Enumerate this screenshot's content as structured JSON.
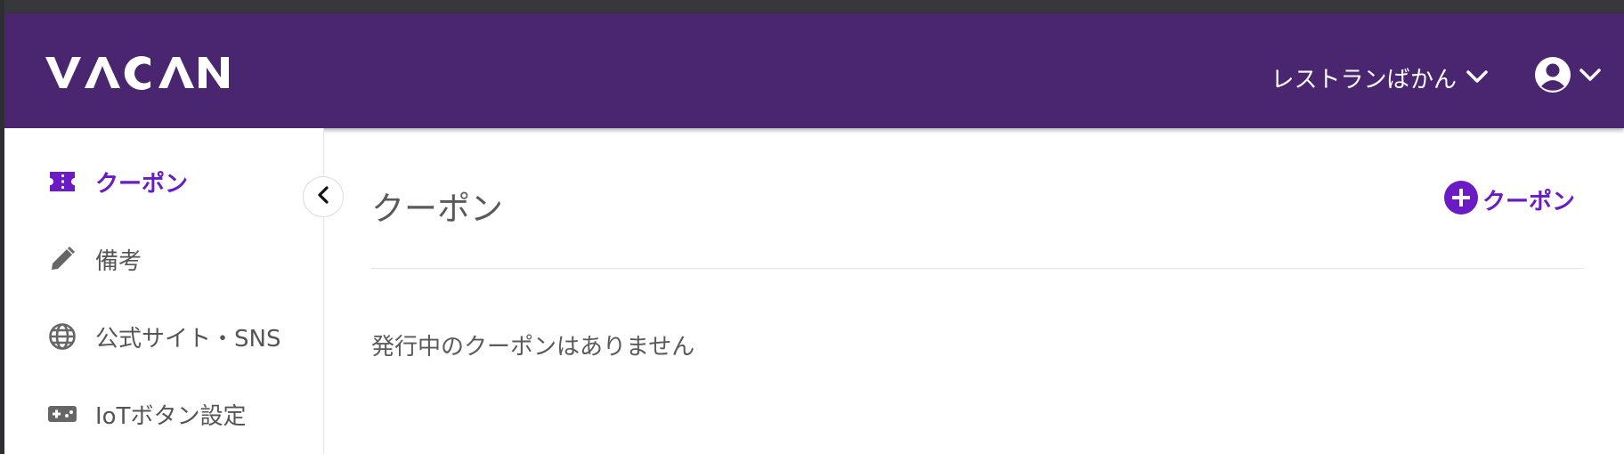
{
  "header": {
    "logo_text": "VACAN",
    "restaurant_name": "レストランばかん",
    "icons": {
      "restaurant_chevron": "chevron-down-icon",
      "account": "account-circle-icon",
      "account_chevron": "chevron-down-icon"
    }
  },
  "sidebar": {
    "items": [
      {
        "label": "クーポン",
        "icon": "ticket-icon",
        "active": true
      },
      {
        "label": "備考",
        "icon": "pencil-icon",
        "active": false
      },
      {
        "label": "公式サイト・SNS",
        "icon": "globe-icon",
        "active": false
      },
      {
        "label": "IoTボタン設定",
        "icon": "gamepad-icon",
        "active": false
      }
    ],
    "collapse_icon": "chevron-left-icon"
  },
  "main": {
    "title": "クーポン",
    "add_button_label": "クーポン",
    "add_button_icon": "plus-circle-icon",
    "empty_message": "発行中のクーポンはありません"
  },
  "colors": {
    "header_bg": "#4a2670",
    "accent": "#6b1bc4",
    "text": "#5a5a5a"
  }
}
